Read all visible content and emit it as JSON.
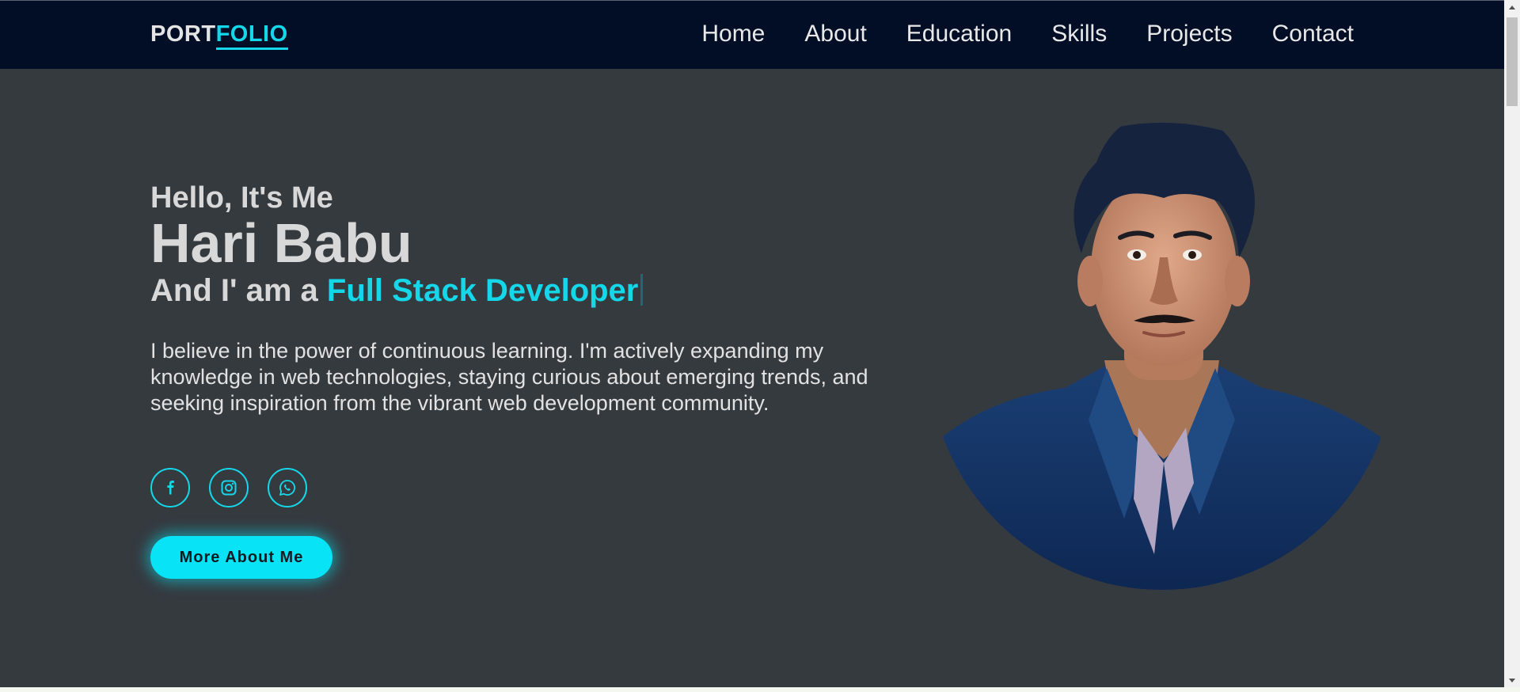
{
  "navbar": {
    "logo_part1": "PORT",
    "logo_part2": "FOLIO",
    "links": [
      "Home",
      "About",
      "Education",
      "Skills",
      "Projects",
      "Contact"
    ]
  },
  "hero": {
    "greeting": "Hello, It's Me",
    "name": "Hari Babu",
    "role_prefix": "And I' am a ",
    "role_highlight": "Full Stack Developer",
    "bio": "I believe in the power of continuous learning. I'm actively expanding my knowledge in web technologies, staying curious about emerging trends, and seeking inspiration from the vibrant web development community.",
    "cta_label": "More About Me"
  },
  "socials": [
    {
      "icon": "facebook-icon"
    },
    {
      "icon": "instagram-icon"
    },
    {
      "icon": "whatsapp-icon"
    }
  ],
  "colors": {
    "accent": "#14d8ea",
    "navbar_bg": "#020e26",
    "page_bg": "#353a3f"
  }
}
